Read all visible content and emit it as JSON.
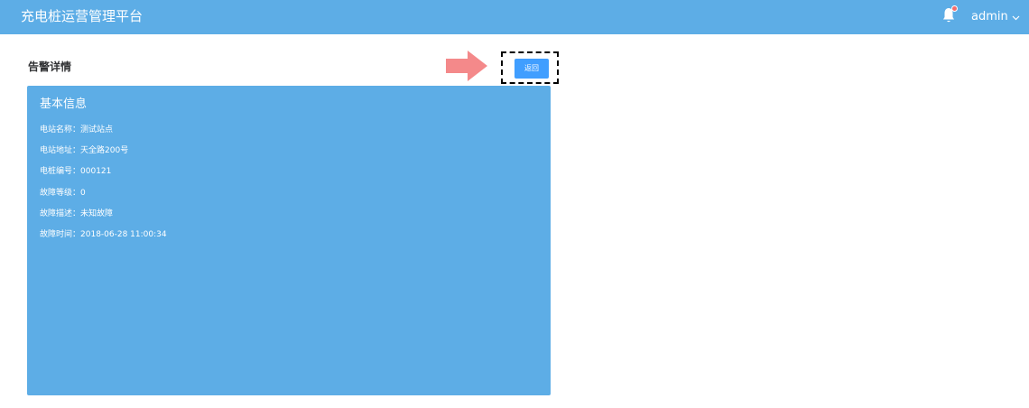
{
  "header": {
    "app_title": "充电桩运营管理平台",
    "user_name": "admin",
    "notification_icon": "bell-icon",
    "has_unread": true,
    "accent_color": "#5DADE6"
  },
  "page": {
    "title": "告警详情",
    "back_label": "返回",
    "button_color": "#409EFF"
  },
  "card": {
    "title": "基本信息",
    "fields": [
      {
        "label": "电站名称：",
        "value": "测试站点"
      },
      {
        "label": "电站地址：",
        "value": "天全路200号"
      },
      {
        "label": "电桩编号：",
        "value": "000121"
      },
      {
        "label": "故障等级：",
        "value": "0"
      },
      {
        "label": "故障描述：",
        "value": "未知故障"
      },
      {
        "label": "故障时间：",
        "value": "2018-06-28 11:00:34"
      }
    ]
  }
}
